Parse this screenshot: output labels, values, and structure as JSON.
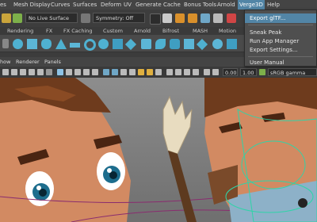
{
  "menubar": {
    "items": [
      "es",
      "Mesh Display",
      "Curves",
      "Surfaces",
      "Deform",
      "UV",
      "Generate",
      "Cache",
      "Bonus Tools",
      "Arnold",
      "Verge3D",
      "Help"
    ],
    "active_index": 10
  },
  "statusline": {
    "surface_dropdown": "No Live Surface",
    "symmetry_dropdown": "Symmetry: Off"
  },
  "shelf": {
    "tabs": [
      "Rendering",
      "FX",
      "FX Caching",
      "Custom",
      "Arnold",
      "Bifrost",
      "MASH",
      "Motion"
    ]
  },
  "panel_menu": {
    "items": [
      "how",
      "Renderer",
      "Panels"
    ]
  },
  "panel_toolbar": {
    "zero_value": "0.00",
    "exposure_value": "1.00",
    "color_space": "sRGB gamma"
  },
  "verge3d_menu": {
    "items": [
      "Export glTF...",
      "Sneak Peak",
      "Run App Manager",
      "Export Settings...",
      "User Manual"
    ],
    "highlighted_index": 0
  },
  "colors": {
    "accent": "#5285a6",
    "shelf_icon": "#4fb1d1"
  }
}
